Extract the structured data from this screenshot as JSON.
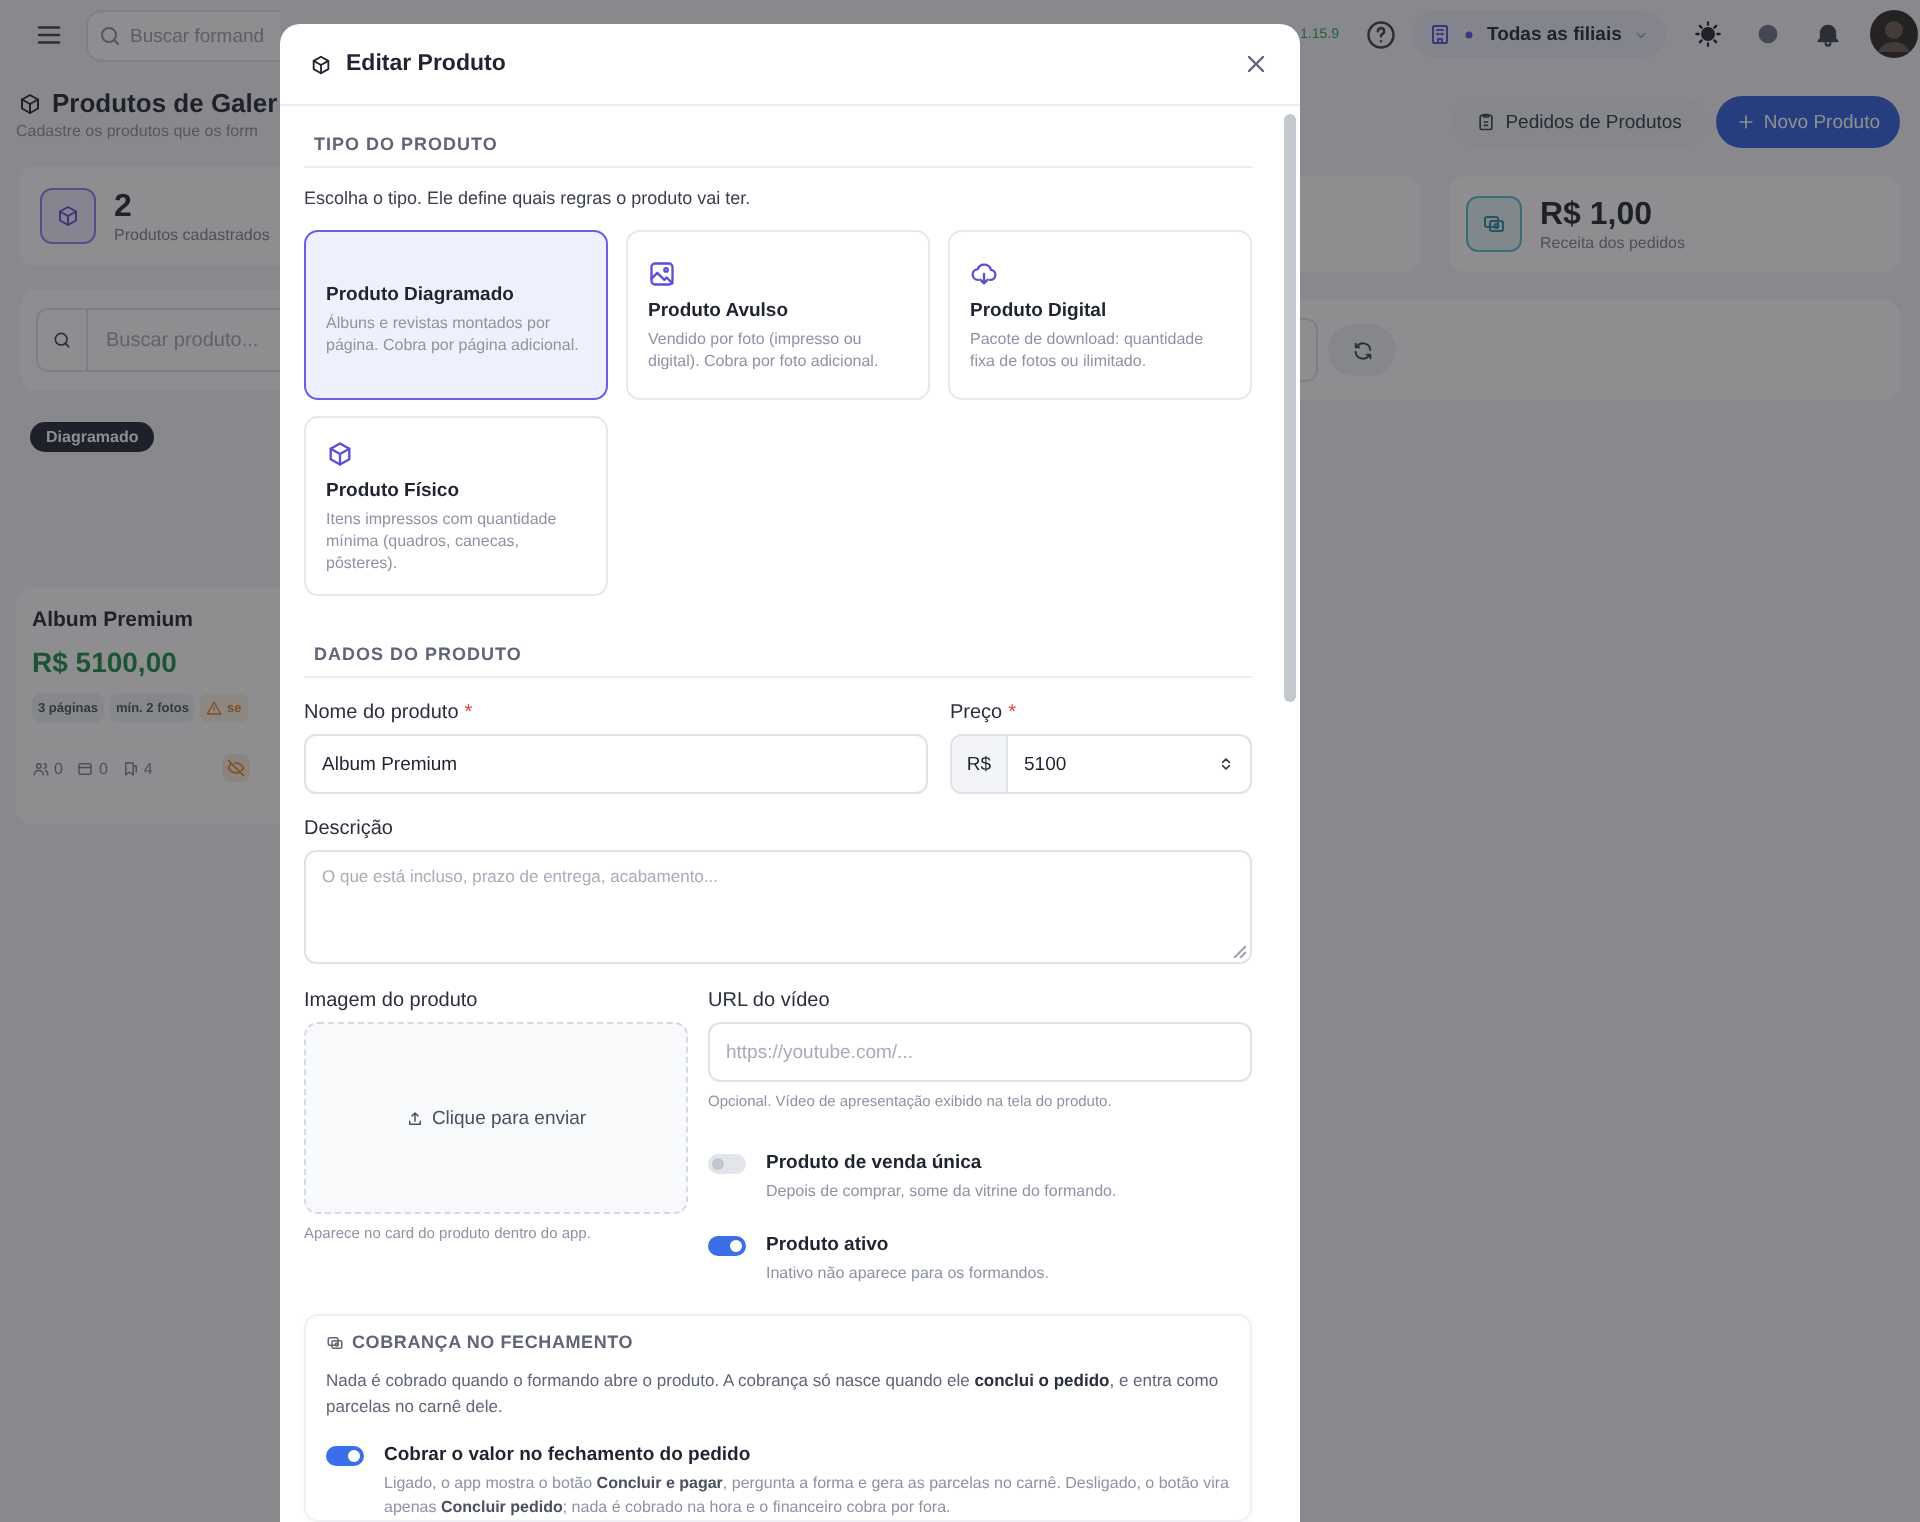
{
  "topbar": {
    "search_placeholder": "Buscar formand",
    "version": "1.15.9",
    "branch_selector": "Todas as filiais"
  },
  "page": {
    "title": "Produtos de Galer",
    "subtitle": "Cadastre os produtos que os form",
    "orders_button": "Pedidos de Produtos",
    "new_button": "Novo Produto"
  },
  "stats": [
    {
      "value": "2",
      "label": "Produtos cadastrados"
    },
    {
      "value": "R$ 1,00",
      "label": "Receita dos pedidos"
    }
  ],
  "filter": {
    "search_placeholder": "Buscar produto..."
  },
  "product_card": {
    "badge": "Diagramado",
    "name": "Album Premium",
    "price": "R$ 5100,00",
    "chips": [
      {
        "text": "3 páginas",
        "kind": "info"
      },
      {
        "text": "mín. 2 fotos",
        "kind": "info"
      },
      {
        "text": "se",
        "kind": "warning"
      }
    ],
    "counts": [
      "0",
      "0",
      "4"
    ]
  },
  "modal": {
    "title": "Editar Produto",
    "type_section": {
      "heading": "TIPO DO PRODUTO",
      "hint": "Escolha o tipo. Ele define quais regras o produto vai ter.",
      "types": [
        {
          "kind": "diagramado",
          "title": "Produto Diagramado",
          "description": "Álbuns e revistas montados por página. Cobra por página adicional.",
          "selected": true
        },
        {
          "kind": "avulso",
          "title": "Produto Avulso",
          "description": "Vendido por foto (impresso ou digital). Cobra por foto adicional.",
          "selected": false
        },
        {
          "kind": "digital",
          "title": "Produto Digital",
          "description": "Pacote de download: quantidade fixa de fotos ou ilimitado.",
          "selected": false
        },
        {
          "kind": "fisico",
          "title": "Produto Físico",
          "description": "Itens impressos com quantidade mínima (quadros, canecas, pôsteres).",
          "selected": false
        }
      ]
    },
    "data_section": {
      "heading": "DADOS DO PRODUTO",
      "name": {
        "label": "Nome do produto",
        "required_mark": "*",
        "value": "Album Premium"
      },
      "price": {
        "label": "Preço",
        "required_mark": "*",
        "currency": "R$",
        "value": "5100"
      },
      "description": {
        "label": "Descrição",
        "placeholder": "O que está incluso, prazo de entrega, acabamento..."
      },
      "image": {
        "label": "Imagem do produto",
        "upload_text": "Clique para enviar",
        "hint": "Aparece no card do produto dentro do app."
      },
      "video": {
        "label": "URL do vídeo",
        "placeholder": "https://youtube.com/...",
        "hint": "Opcional. Vídeo de apresentação exibido na tela do produto."
      },
      "toggles": [
        {
          "label": "Produto de venda única",
          "description": "Depois de comprar, some da vitrine do formando.",
          "on": false
        },
        {
          "label": "Produto ativo",
          "description": "Inativo não aparece para os formandos.",
          "on": true
        }
      ]
    },
    "billing": {
      "heading": "COBRANÇA NO FECHAMENTO",
      "text": "Nada é cobrado quando o formando abre o produto. A cobrança só nasce quando ele **conclui o pedido**, e entra como parcelas no carnê dele.",
      "toggle": {
        "label": "Cobrar o valor no fechamento do pedido",
        "description": "Ligado, o app mostra o botão **Concluir e pagar**, pergunta a forma e gera as parcelas no carnê. Desligado, o botão vira apenas **Concluir pedido**; nada é cobrado na hora e o financeiro cobra por fora.",
        "on": true
      }
    }
  }
}
